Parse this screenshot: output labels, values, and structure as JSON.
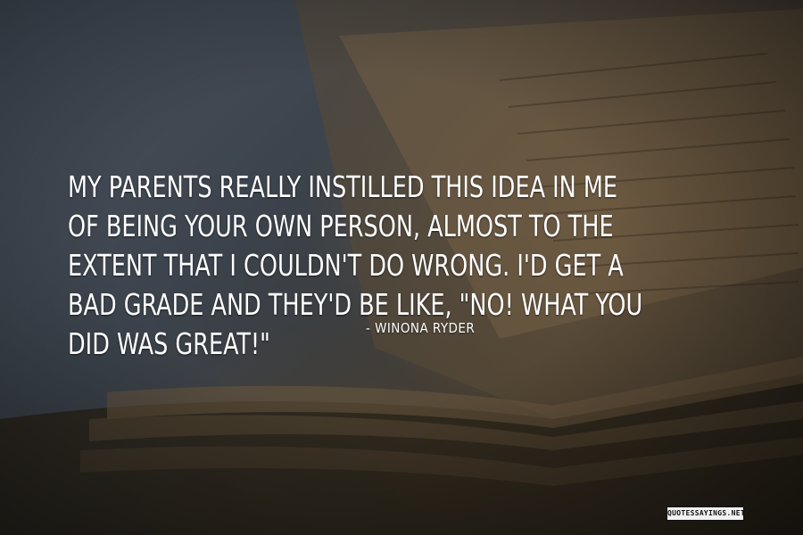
{
  "quote": {
    "text": "MY PARENTS REALLY INSTILLED THIS IDEA IN ME OF BEING YOUR OWN PERSON, ALMOST TO THE EXTENT THAT I COULDN'T DO WRONG. I'D GET A BAD GRADE AND THEY'D BE LIKE, \"NO! WHAT YOU DID WAS GREAT!\"",
    "author": "- WINONA RYDER"
  },
  "watermark": {
    "text": "QUOTESSAYINGS.NET"
  },
  "background": {
    "subject": "old-open-book-photo"
  }
}
